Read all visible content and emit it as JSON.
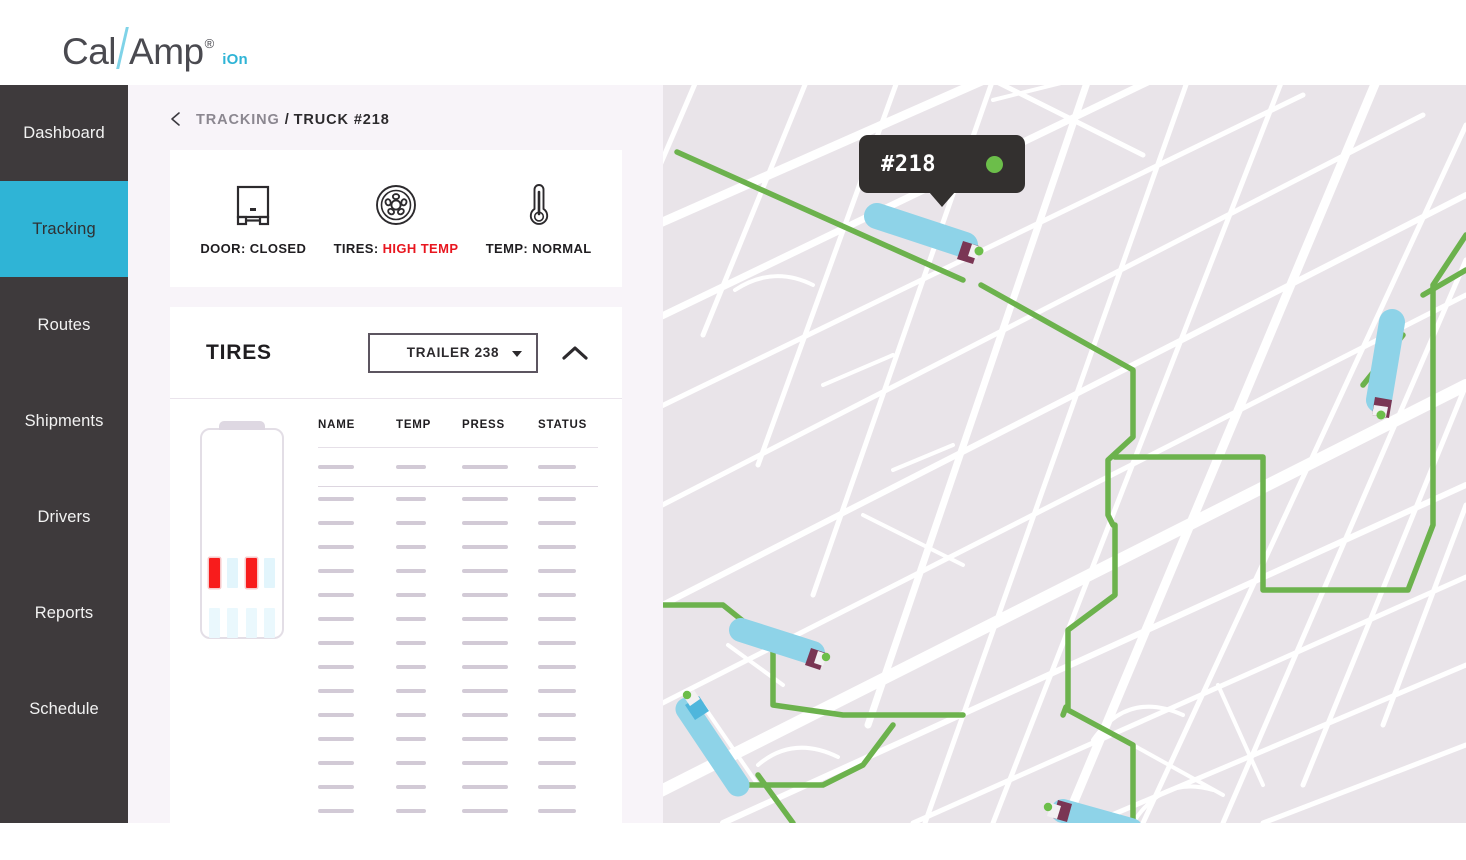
{
  "brand": {
    "name_part1": "Cal",
    "name_part2": "Amp",
    "registered": "®",
    "product": "iOn",
    "accent_color": "#2fb4d6",
    "slash_color": "#7fd3e8"
  },
  "sidebar": {
    "items": [
      {
        "label": "Dashboard",
        "active": false
      },
      {
        "label": "Tracking",
        "active": true
      },
      {
        "label": "Routes",
        "active": false
      },
      {
        "label": "Shipments",
        "active": false
      },
      {
        "label": "Drivers",
        "active": false
      },
      {
        "label": "Reports",
        "active": false
      },
      {
        "label": "Schedule",
        "active": false
      }
    ],
    "bg_color": "#3e3a3c",
    "active_color": "#2fb4d6"
  },
  "breadcrumb": {
    "back_icon": "chevron-left-icon",
    "section": "TRACKING",
    "separator": "/",
    "current": "TRUCK #218"
  },
  "status_card": {
    "items": [
      {
        "icon": "trailer-door-icon",
        "prefix": "DOOR:",
        "value": "CLOSED",
        "alert": false
      },
      {
        "icon": "tire-wheel-icon",
        "prefix": "TIRES:",
        "value": "HIGH TEMP",
        "alert": true
      },
      {
        "icon": "thermometer-icon",
        "prefix": "TEMP:",
        "value": "NORMAL",
        "alert": false
      }
    ],
    "alert_color": "#e8161f"
  },
  "tires_panel": {
    "title": "TIRES",
    "trailer_select": {
      "value": "TRAILER 238",
      "caret_icon": "chevron-down-icon"
    },
    "collapse_icon": "chevron-up-icon",
    "diagram": {
      "name": "trailer-top-view",
      "axles": [
        {
          "name": "front-axle",
          "left_tires": [
            {
              "status": "high-temp"
            },
            {
              "status": "normal"
            }
          ],
          "right_tires": [
            {
              "status": "high-temp"
            },
            {
              "status": "normal"
            }
          ]
        },
        {
          "name": "rear-axle",
          "left_tires": [
            {
              "status": "normal"
            },
            {
              "status": "normal"
            }
          ],
          "right_tires": [
            {
              "status": "normal"
            },
            {
              "status": "normal"
            }
          ]
        }
      ],
      "hot_color": "#f81c1c",
      "normal_color": "#e2f5fc"
    },
    "table": {
      "columns": [
        "NAME",
        "TEMP",
        "PRESS",
        "STATUS"
      ],
      "rows_loading": true,
      "lead_row_count": 1,
      "body_row_count": 14
    }
  },
  "map": {
    "background_color": "#e9e4e9",
    "road_color": "#ffffff",
    "route_color": "#6cb24d",
    "vehicle_body_color": "#8ed3e8",
    "vehicle_cab_color": "#7a3654",
    "tooltip": {
      "label": "#218",
      "status_dot_color": "#6cbe4a"
    },
    "vehicles": [
      {
        "name": "truck-218",
        "selected": true
      },
      {
        "name": "truck-right-edge",
        "selected": false
      },
      {
        "name": "truck-lower-left",
        "selected": false
      },
      {
        "name": "truck-lower-center",
        "selected": false
      },
      {
        "name": "truck-lower-right",
        "selected": false
      }
    ]
  }
}
